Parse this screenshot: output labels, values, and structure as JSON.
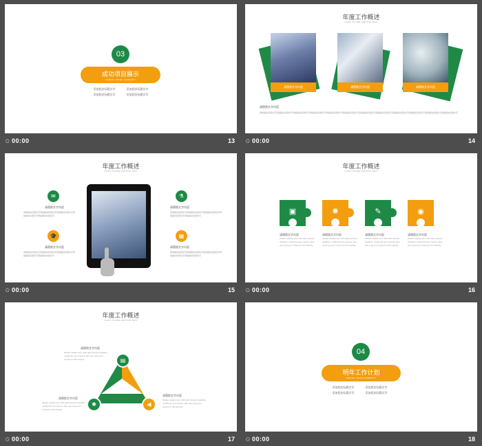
{
  "slides": [
    {
      "number": "13",
      "time": "00:00",
      "section_number": "03",
      "pill_title": "成功项目展示",
      "pill_sub": "ANNUAL WORK SUMMARY",
      "bullets": [
        "· 添加相关标题文字",
        "· 添加相关标题文字",
        "· 添加相关标题文字",
        "· 添加相关标题文字"
      ]
    },
    {
      "number": "14",
      "time": "00:00",
      "title": "年度工作概述",
      "subtitle": "CLICK TO ADD CAPTION TEXT",
      "captions": [
        "请替换文字内容",
        "请替换文字内容",
        "请替换文字内容"
      ],
      "text_label": "请替换文字内容",
      "body": "添加相关标题文字添加相关标题文字添加相关标题文字添加相关标题文字添加相关标题文字添加相关标题文字添加相关标题文字添加相关标题文字添加相关标题文字添加相关标题文字添加相关标题文字添加相关标题文字"
    },
    {
      "number": "15",
      "time": "00:00",
      "title": "年度工作概述",
      "subtitle": "CLICK TO ADD CAPTION TEXT",
      "item_label": "请替换文字内容",
      "item_text": "添加相关标题文字添加相关标题文字添加相关标题文字添加相关标题文字添加相关标题文字"
    },
    {
      "number": "16",
      "time": "00:00",
      "title": "年度工作概述",
      "subtitle": "CLICK TO ADD CAPTION TEXT",
      "item_label": "请替换文字内容",
      "item_text": "Please replace text, click add relevant headline, modify the text content, also can copy your content to this directly."
    },
    {
      "number": "17",
      "time": "00:00",
      "title": "年度工作概述",
      "subtitle": "CLICK TO ADD CAPTION TEXT",
      "item_label": "请替换文字内容",
      "item_text": "Please replace text, click add relevant headline, modify the text content, also can copy your content to this directly."
    },
    {
      "number": "18",
      "time": "00:00",
      "section_number": "04",
      "pill_title": "明年工作计划",
      "pill_sub": "ANNUAL WORK SUMMARY",
      "bullets": [
        "· 添加相关标题文字",
        "· 添加相关标题文字",
        "· 添加相关标题文字",
        "· 添加相关标题文字"
      ]
    }
  ],
  "colors": {
    "green": "#1e8a46",
    "orange": "#f29e0f",
    "bg": "#4d4d4d"
  },
  "icons": [
    "star-icon",
    "mail-icon",
    "microscope-icon",
    "graduation-cap-icon",
    "calculator-icon",
    "briefcase-icon",
    "lightbulb-icon",
    "pencil-icon",
    "eye-icon",
    "megaphone-icon"
  ]
}
